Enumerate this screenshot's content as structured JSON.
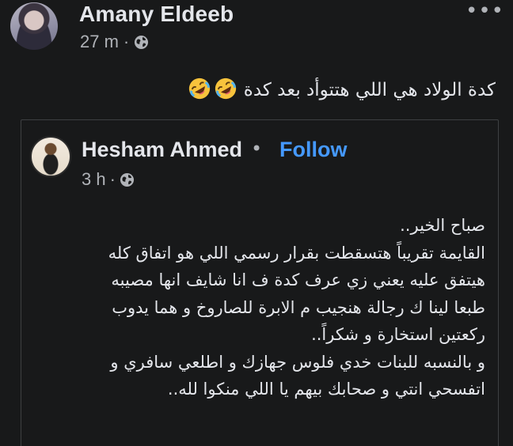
{
  "post": {
    "author": "Amany Eldeeb",
    "time": "27 m",
    "separator": "·",
    "privacy_icon": "globe-icon",
    "more_label": "•••",
    "caption": "كدة الولاد هي اللي هتتوأد بعد كدة",
    "caption_emoji": [
      "rolling-on-floor-laughing-emoji",
      "rolling-on-floor-laughing-emoji"
    ]
  },
  "shared": {
    "author": "Hesham Ahmed",
    "separator": "•",
    "follow_label": "Follow",
    "time": "3 h",
    "time_separator": "·",
    "privacy_icon": "globe-icon",
    "body_lines": [
      "صباح الخير..",
      "القايمة تقريباً هتسقطت بقرار رسمي اللي هو اتفاق كله",
      "هيتفق عليه يعني زي عرف كدة ف انا شايف انها مصيبه",
      "طبعا لينا ك رجالة هنجيب م الابرة للصاروخ و هما يدوب",
      "ركعتين استخارة و شكراً..",
      "و بالنسبه للبنات خدي فلوس جهازك و اطلعي سافري و",
      "اتفسحي انتي و صحابك بيهم يا اللي منكوا لله.."
    ]
  },
  "colors": {
    "background": "#18191a",
    "text_primary": "#e4e6eb",
    "text_secondary": "#b0b3b8",
    "follow_link": "#4599ff",
    "card_border": "#3e4042"
  }
}
